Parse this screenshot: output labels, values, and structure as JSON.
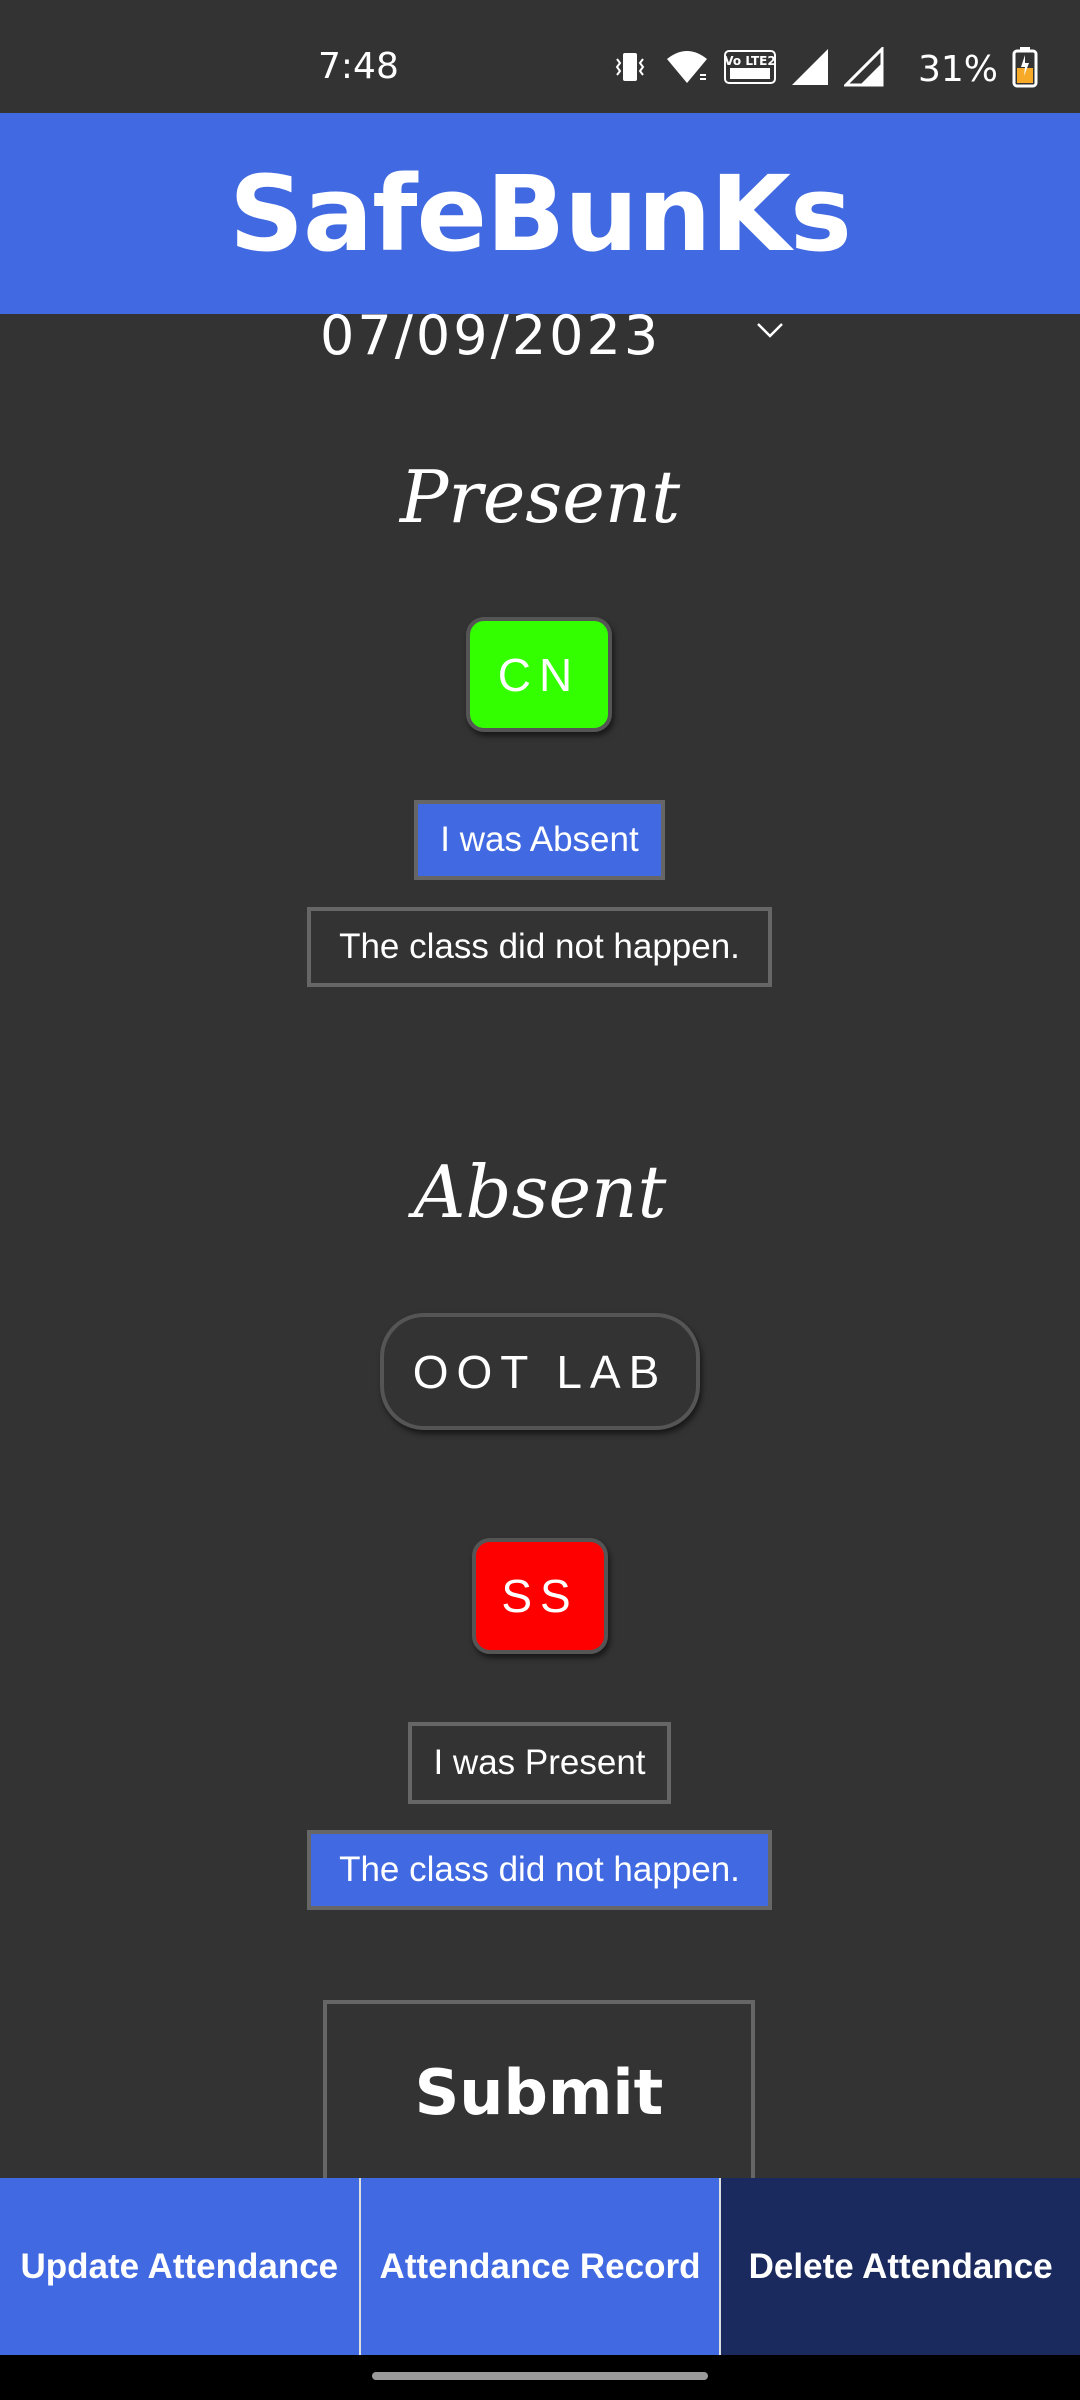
{
  "status_bar": {
    "time": "7:48",
    "battery": "31%",
    "icons": [
      "vibrate-icon",
      "wifi-icon",
      "volte-icon",
      "signal-icon",
      "signal-icon",
      "battery-charging-icon"
    ],
    "volte_text": "Vo LTE2"
  },
  "header": {
    "title": "SafeBunKs",
    "color": "#4169E1"
  },
  "date_select": {
    "value": "07/09/2023"
  },
  "present_section": {
    "title": "Present",
    "subjects": [
      {
        "code": "CN",
        "color": "#33FF00",
        "buttons": [
          "I was Absent",
          "The class did not happen."
        ],
        "selected": "I was Absent"
      }
    ]
  },
  "absent_section": {
    "title": "Absent",
    "subjects": [
      {
        "code": "OOT LAB",
        "buttons": []
      },
      {
        "code": "SS",
        "color": "#FF0000",
        "buttons": [
          "I was Present",
          "The class did not happen."
        ],
        "selected": "The class did not happen."
      }
    ]
  },
  "submit": {
    "label": "Submit"
  },
  "bottom_nav": [
    {
      "label": "Update Attendance"
    },
    {
      "label": "Attendance Record"
    },
    {
      "label": "Delete Attendance",
      "active": true
    }
  ]
}
